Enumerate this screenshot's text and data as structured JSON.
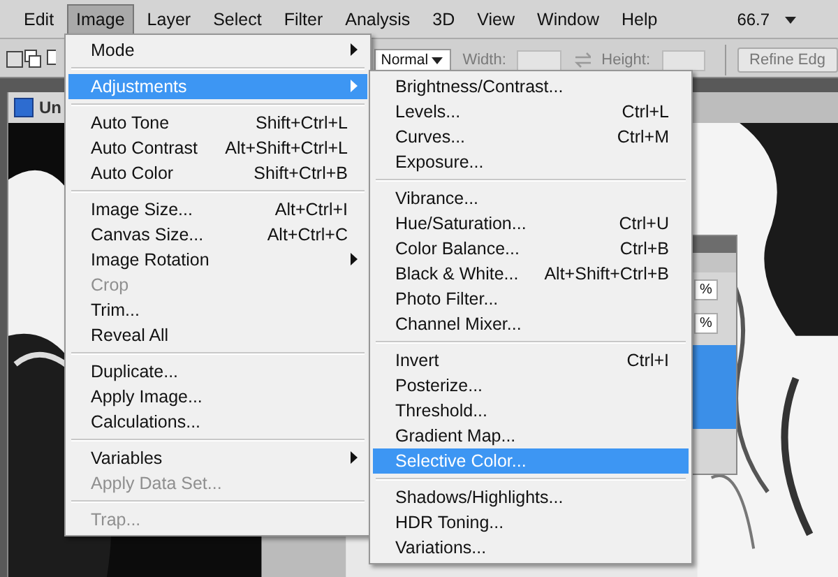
{
  "menubar": {
    "items": [
      {
        "label": "Edit",
        "selected": false
      },
      {
        "label": "Image",
        "selected": true
      },
      {
        "label": "Layer",
        "selected": false
      },
      {
        "label": "Select",
        "selected": false
      },
      {
        "label": "Filter",
        "selected": false
      },
      {
        "label": "Analysis",
        "selected": false
      },
      {
        "label": "3D",
        "selected": false
      },
      {
        "label": "View",
        "selected": false
      },
      {
        "label": "Window",
        "selected": false
      },
      {
        "label": "Help",
        "selected": false
      }
    ],
    "zoom": "66.7"
  },
  "options_bar": {
    "style": "Normal",
    "width_label": "Width:",
    "height_label": "Height:",
    "refine_button": "Refine Edg"
  },
  "document": {
    "tab_title": "Un"
  },
  "panel": {
    "fields": [
      "%",
      "%"
    ]
  },
  "image_menu": [
    [
      {
        "label": "Mode",
        "submenu": true,
        "disabled": false,
        "selected": false
      }
    ],
    [
      {
        "label": "Adjustments",
        "submenu": true,
        "disabled": false,
        "selected": true
      }
    ],
    [
      {
        "label": "Auto Tone",
        "shortcut": "Shift+Ctrl+L",
        "submenu": false,
        "disabled": false,
        "selected": false
      },
      {
        "label": "Auto Contrast",
        "shortcut": "Alt+Shift+Ctrl+L",
        "submenu": false,
        "disabled": false,
        "selected": false
      },
      {
        "label": "Auto Color",
        "shortcut": "Shift+Ctrl+B",
        "submenu": false,
        "disabled": false,
        "selected": false
      }
    ],
    [
      {
        "label": "Image Size...",
        "shortcut": "Alt+Ctrl+I",
        "submenu": false,
        "disabled": false,
        "selected": false
      },
      {
        "label": "Canvas Size...",
        "shortcut": "Alt+Ctrl+C",
        "submenu": false,
        "disabled": false,
        "selected": false
      },
      {
        "label": "Image Rotation",
        "submenu": true,
        "disabled": false,
        "selected": false
      },
      {
        "label": "Crop",
        "submenu": false,
        "disabled": true,
        "selected": false
      },
      {
        "label": "Trim...",
        "submenu": false,
        "disabled": false,
        "selected": false
      },
      {
        "label": "Reveal All",
        "submenu": false,
        "disabled": false,
        "selected": false
      }
    ],
    [
      {
        "label": "Duplicate...",
        "submenu": false,
        "disabled": false,
        "selected": false
      },
      {
        "label": "Apply Image...",
        "submenu": false,
        "disabled": false,
        "selected": false
      },
      {
        "label": "Calculations...",
        "submenu": false,
        "disabled": false,
        "selected": false
      }
    ],
    [
      {
        "label": "Variables",
        "submenu": true,
        "disabled": false,
        "selected": false
      },
      {
        "label": "Apply Data Set...",
        "submenu": false,
        "disabled": true,
        "selected": false
      }
    ],
    [
      {
        "label": "Trap...",
        "submenu": false,
        "disabled": true,
        "selected": false
      }
    ]
  ],
  "adjustments_menu": [
    [
      {
        "label": "Brightness/Contrast...",
        "selected": false
      },
      {
        "label": "Levels...",
        "shortcut": "Ctrl+L",
        "selected": false
      },
      {
        "label": "Curves...",
        "shortcut": "Ctrl+M",
        "selected": false
      },
      {
        "label": "Exposure...",
        "selected": false
      }
    ],
    [
      {
        "label": "Vibrance...",
        "selected": false
      },
      {
        "label": "Hue/Saturation...",
        "shortcut": "Ctrl+U",
        "selected": false
      },
      {
        "label": "Color Balance...",
        "shortcut": "Ctrl+B",
        "selected": false
      },
      {
        "label": "Black & White...",
        "shortcut": "Alt+Shift+Ctrl+B",
        "selected": false
      },
      {
        "label": "Photo Filter...",
        "selected": false
      },
      {
        "label": "Channel Mixer...",
        "selected": false
      }
    ],
    [
      {
        "label": "Invert",
        "shortcut": "Ctrl+I",
        "selected": false
      },
      {
        "label": "Posterize...",
        "selected": false
      },
      {
        "label": "Threshold...",
        "selected": false
      },
      {
        "label": "Gradient Map...",
        "selected": false
      },
      {
        "label": "Selective Color...",
        "selected": true
      }
    ],
    [
      {
        "label": "Shadows/Highlights...",
        "selected": false
      },
      {
        "label": "HDR Toning...",
        "selected": false
      },
      {
        "label": "Variations...",
        "selected": false
      }
    ]
  ]
}
